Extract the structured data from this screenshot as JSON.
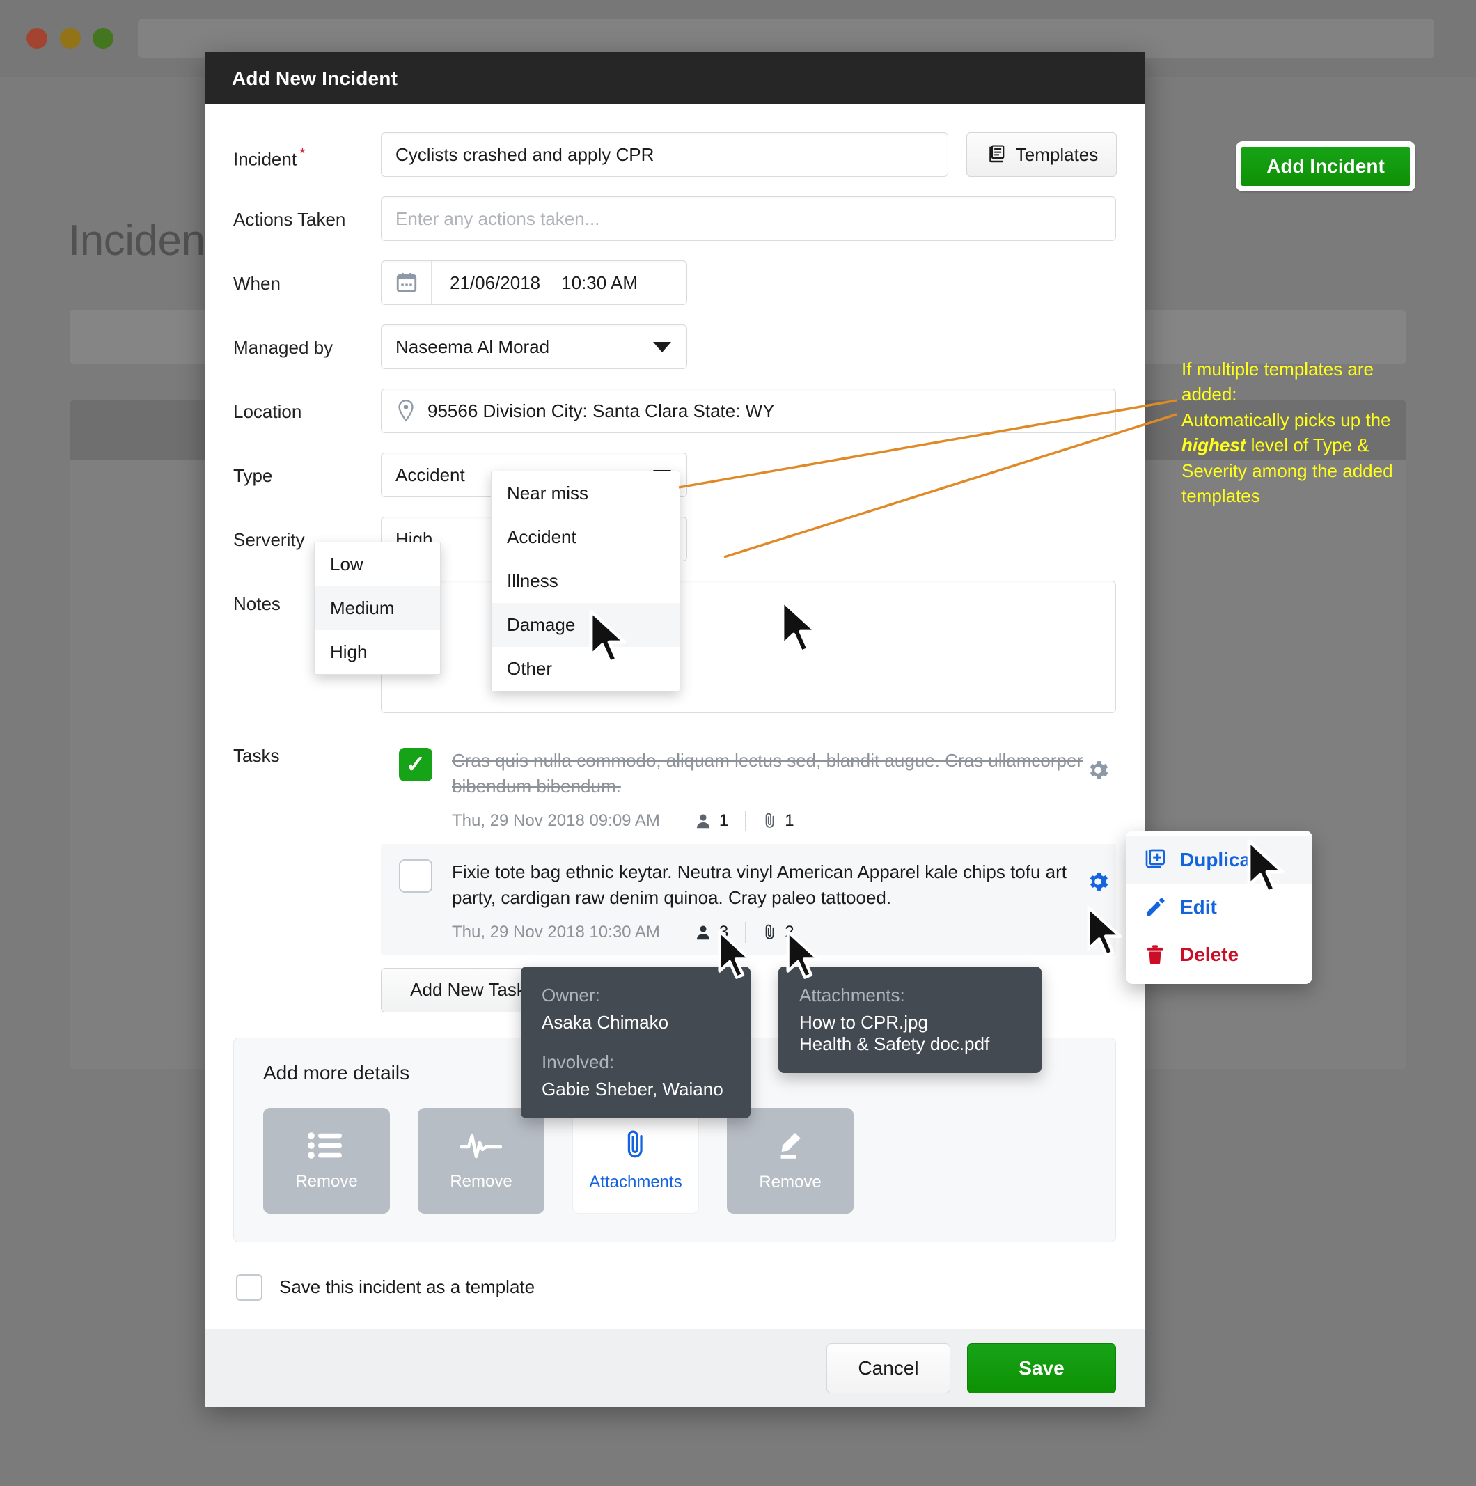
{
  "background": {
    "page_title": "Incident",
    "add_incident_label": "Add Incident",
    "accent_green": "#0f9104"
  },
  "modal": {
    "title": "Add New Incident",
    "fields": {
      "incident": {
        "label": "Incident",
        "required_marker": "*",
        "value": "Cyclists crashed and apply CPR"
      },
      "templates_button": "Templates",
      "actions_taken": {
        "label": "Actions Taken",
        "value": "",
        "placeholder": "Enter any actions taken..."
      },
      "when": {
        "label": "When",
        "date": "21/06/2018",
        "time": "10:30 AM"
      },
      "managed_by": {
        "label": "Managed by",
        "value": "Naseema Al Morad"
      },
      "location": {
        "label": "Location",
        "value": "95566 Division City: Santa Clara State: WY"
      },
      "type": {
        "label": "Type",
        "value": "Accident"
      },
      "severity": {
        "label": "Serverity",
        "value": "High"
      },
      "notes": {
        "label": "Notes",
        "value": ""
      },
      "tasks": {
        "label": "Tasks"
      }
    },
    "type_dropdown": {
      "options": [
        "Near miss",
        "Accident",
        "Illness",
        "Damage",
        "Other"
      ],
      "highlighted": "Damage"
    },
    "severity_dropdown": {
      "options": [
        "Low",
        "Medium",
        "High"
      ],
      "highlighted": "Medium"
    },
    "tasks": [
      {
        "completed": true,
        "text": "Cras quis nulla commodo, aliquam lectus sed, blandit augue. Cras ullamcorper bibendum bibendum.",
        "date": "Thu, 29 Nov 2018 09:09 AM",
        "people_count": "1",
        "attachment_count": "1"
      },
      {
        "completed": false,
        "text": "Fixie tote bag ethnic keytar. Neutra vinyl American Apparel kale chips tofu art party, cardigan raw denim quinoa. Cray paleo tattooed.",
        "date": "Thu, 29 Nov 2018 10:30 AM",
        "people_count": "3",
        "attachment_count": "2"
      }
    ],
    "add_new_task_label": "Add New Task",
    "more_details": {
      "title": "Add more details",
      "tiles": [
        {
          "icon": "list-icon",
          "label": "Remove",
          "state": "added"
        },
        {
          "icon": "vitals-icon",
          "label": "Remove",
          "state": "added"
        },
        {
          "icon": "paperclip-icon",
          "label": "Attachments",
          "state": "available"
        },
        {
          "icon": "pencil-icon",
          "label": "Remove",
          "state": "added"
        }
      ]
    },
    "save_as_template_label": "Save this incident as a template",
    "footer": {
      "cancel_label": "Cancel",
      "save_label": "Save"
    }
  },
  "tooltips": {
    "owner": {
      "owner_label": "Owner:",
      "owner_value": "Asaka Chimako",
      "involved_label": "Involved:",
      "involved_value": "Gabie Sheber, Waiano"
    },
    "attachments": {
      "label": "Attachments:",
      "files": [
        "How to CPR.jpg",
        "Health & Safety doc.pdf"
      ]
    }
  },
  "context_menu": {
    "items": [
      {
        "label": "Duplicate",
        "icon": "duplicate-icon",
        "color": "#1464e0",
        "highlighted": true
      },
      {
        "label": "Edit",
        "icon": "pencil-icon",
        "color": "#1464e0",
        "highlighted": false
      },
      {
        "label": "Delete",
        "icon": "trash-icon",
        "color": "#cc0d28",
        "highlighted": false
      }
    ]
  },
  "annotation": {
    "line1": "If multiple templates are",
    "line2": "added:",
    "line3": "Automatically picks up the",
    "emphasis": "highest",
    "line4": " level of Type &",
    "line5": "Severity among the added",
    "line6": "templates",
    "color": "#ffff1a",
    "arrow_color": "#e08a27"
  }
}
